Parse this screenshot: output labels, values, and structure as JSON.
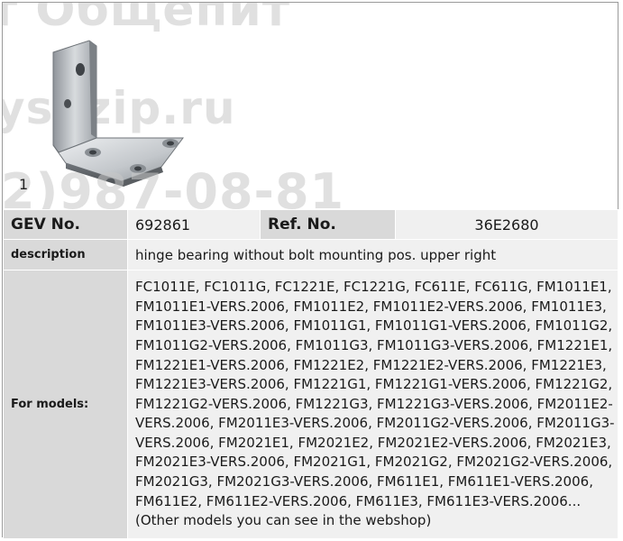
{
  "watermarks": [
    "т Общепит",
    "ysezip.ru",
    "2)987-08-81"
  ],
  "figure_number": "1",
  "spec": {
    "gev_label": "GEV No.",
    "gev_value": "692861",
    "ref_label": "Ref. No.",
    "ref_value": "36E2680",
    "description_label": "description",
    "description_value": "hinge bearing  without bolt mounting pos. upper right",
    "models_label": "For models:",
    "models_lines": [
      "FC1011E, FC1011G, FC1221E, FC1221G, FC611E, FC611G, FM1011E1,",
      "FM1011E1-VERS.2006, FM1011E2, FM1011E2-VERS.2006, FM1011E3,",
      "FM1011E3-VERS.2006, FM1011G1, FM1011G1-VERS.2006, FM1011G2,",
      "FM1011G2-VERS.2006, FM1011G3, FM1011G3-VERS.2006, FM1221E1,",
      "FM1221E1-VERS.2006, FM1221E2, FM1221E2-VERS.2006, FM1221E3,",
      "FM1221E3-VERS.2006, FM1221G1, FM1221G1-VERS.2006, FM1221G2,",
      "FM1221G2-VERS.2006, FM1221G3, FM1221G3-VERS.2006, FM2011E2-",
      "VERS.2006, FM2011E3-VERS.2006, FM2011G2-VERS.2006, FM2011G3-",
      "VERS.2006, FM2021E1, FM2021E2, FM2021E2-VERS.2006, FM2021E3,",
      "FM2021E3-VERS.2006, FM2021G1, FM2021G2, FM2021G2-VERS.2006,",
      "FM2021G3, FM2021G3-VERS.2006, FM611E1, FM611E1-VERS.2006,",
      "FM611E2, FM611E2-VERS.2006, FM611E3, FM611E3-VERS.2006...",
      "(Other models you can see in the webshop)"
    ]
  }
}
